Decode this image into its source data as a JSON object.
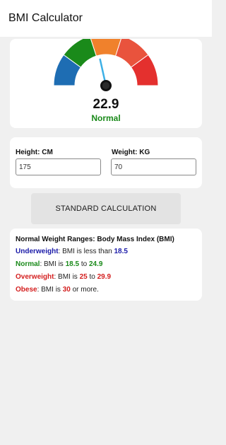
{
  "app": {
    "title": "BMI Calculator"
  },
  "gauge": {
    "value": "22.9",
    "status": "Normal",
    "status_color": "#1a8a1a",
    "needle_value": 22.9,
    "segment_colors": [
      "#1e6db3",
      "#1a8a1a",
      "#f0812c",
      "#e9533d",
      "#e4302e"
    ]
  },
  "inputs": {
    "height_label": "Height: CM",
    "height_value": "175",
    "weight_label": "Weight: KG",
    "weight_value": "70"
  },
  "button": {
    "label": "STANDARD CALCULATION"
  },
  "ranges": {
    "title": "Normal Weight Ranges: Body Mass Index (BMI)",
    "underweight": {
      "label": "Underweight",
      "text": ": BMI is less than ",
      "v1": "18.5",
      "color": "#1a1aa8"
    },
    "normal": {
      "label": "Normal",
      "text1": ": BMI is ",
      "v1": "18.5",
      "text2": " to ",
      "v2": "24.9",
      "color": "#1a8a1a"
    },
    "overweight": {
      "label": "Overweight",
      "text1": ": BMI is ",
      "v1": "25",
      "text2": "  to ",
      "v2": "29.9",
      "color": "#d42020"
    },
    "obese": {
      "label": "Obese",
      "text1": ": BMI is ",
      "v1": "30",
      "text2": "  or more.",
      "color": "#d42020"
    }
  }
}
